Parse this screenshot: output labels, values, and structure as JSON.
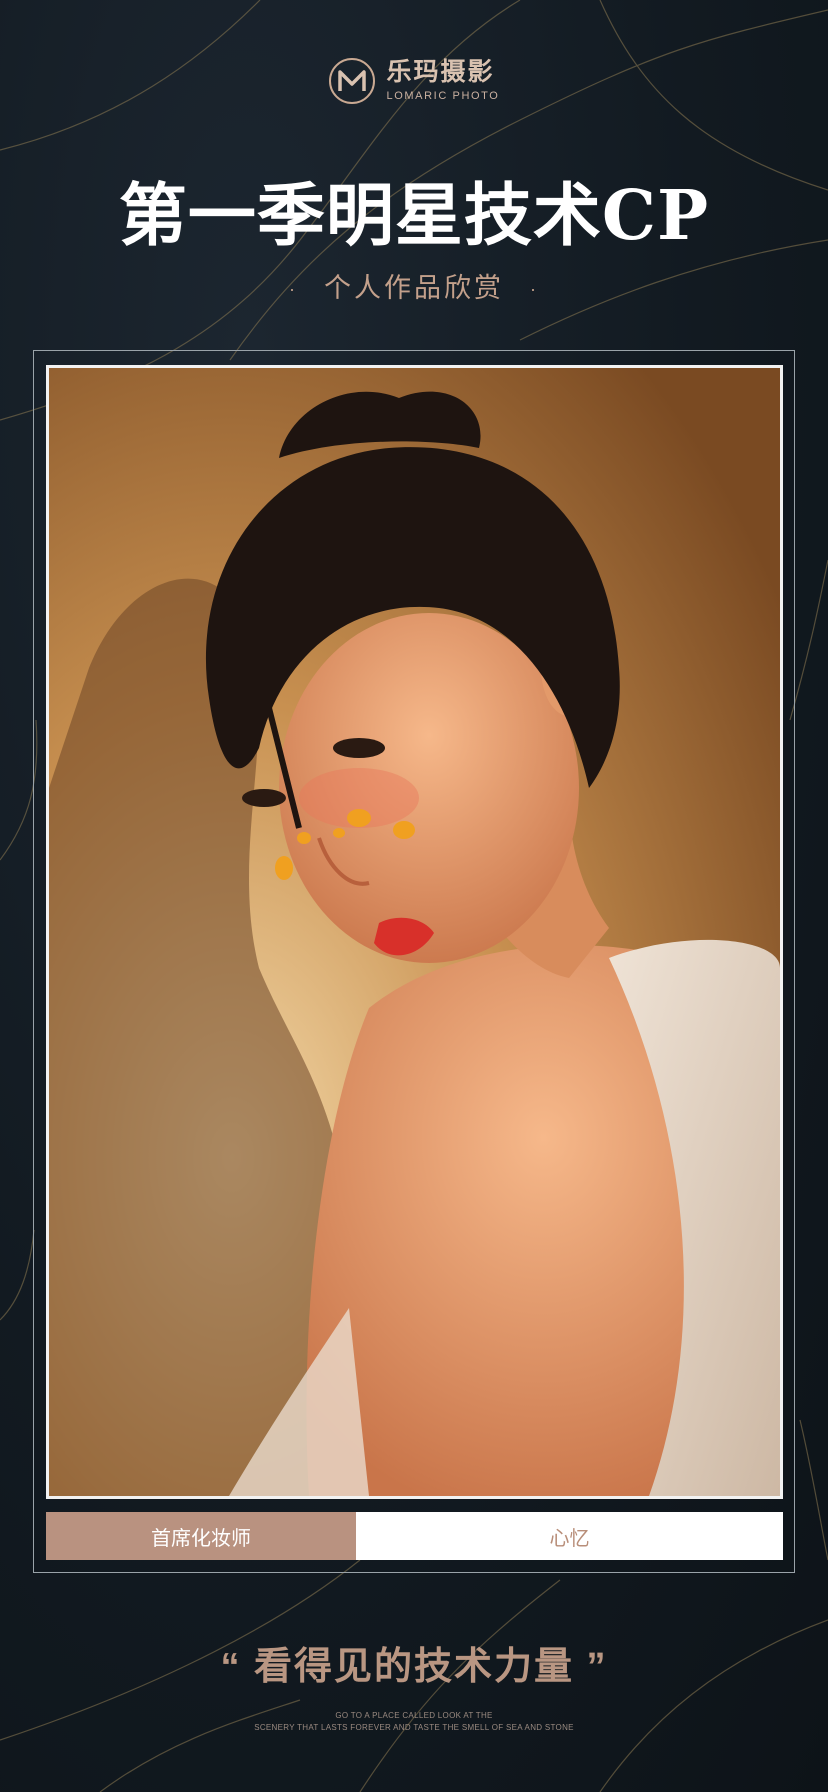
{
  "brand": {
    "name_cn": "乐玛摄影",
    "name_en": "LOMARIC PHOTO",
    "mark": "M",
    "logo_icon": "lomaric-logo-icon"
  },
  "title": "第一季明星技术CP",
  "subtitle": {
    "text": "个人作品欣赏",
    "dot": "·"
  },
  "photo": {
    "subject": "portrait-photo"
  },
  "credit": {
    "role": "首席化妆师",
    "name": "心忆"
  },
  "slogan": "“ 看得见的技术力量 ”",
  "footer": {
    "line1": "GO TO A PLACE CALLED LOOK AT THE",
    "line2": "SCENERY THAT LASTS FOREVER AND TASTE THE SMELL OF SEA AND STONE"
  },
  "colors": {
    "background": "#121a21",
    "accent": "#b99280",
    "gold_vein": "#8c7a52",
    "frame": "#f2f2f2"
  }
}
